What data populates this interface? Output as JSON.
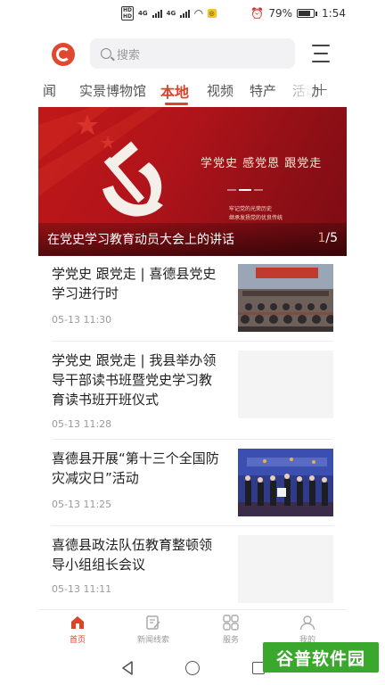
{
  "status_bar": {
    "signal_badges": [
      "HD",
      "HD"
    ],
    "network_labels": [
      "4G",
      "4G"
    ],
    "battery_percent": "79%",
    "time": "1:54",
    "battery_fill": 0.79
  },
  "header": {
    "search_placeholder": "搜索"
  },
  "tabs": {
    "items": [
      "闻",
      "实景博物馆",
      "本地",
      "视频",
      "特产",
      "活动"
    ],
    "active_index": 2,
    "add_label": "+"
  },
  "banner": {
    "headline": "学党史 感党恩 跟党走",
    "sub_line_1": "牢记党的光荣历史",
    "sub_line_2": "继承发扬党的优良传统",
    "caption": "在党史学习教育动员大会上的讲话",
    "current_index": "1",
    "total": "/5"
  },
  "news": [
    {
      "title": "学党史 跟党走 | 喜德县党史学习进行时",
      "time": "05-13 11:30",
      "thumb": "meeting-hall-photo"
    },
    {
      "title": "学党史 跟党走 | 我县举办领导干部读书班暨党史学习教育读书班开班仪式",
      "time": "05-13 11:28",
      "thumb": "placeholder"
    },
    {
      "title": "喜德县开展“第十三个全国防灾减灾日”活动",
      "time": "05-13 11:25",
      "thumb": "stage-event-photo"
    },
    {
      "title": "喜德县政法队伍教育整顿领导小组组长会议",
      "time": "05-13 11:11",
      "thumb": "placeholder"
    }
  ],
  "bottom_nav": {
    "items": [
      {
        "label": "首页",
        "icon": "home-icon",
        "active": true
      },
      {
        "label": "新闻线索",
        "icon": "edit-note-icon",
        "active": false
      },
      {
        "label": "服务",
        "icon": "grid-icon",
        "active": false
      },
      {
        "label": "我的",
        "icon": "user-icon",
        "active": false
      }
    ]
  },
  "watermark": {
    "text": "谷普软件园"
  },
  "colors": {
    "accent": "#d9442b",
    "banner_red": "#b0141a",
    "watermark_green": "#3aa82c"
  }
}
